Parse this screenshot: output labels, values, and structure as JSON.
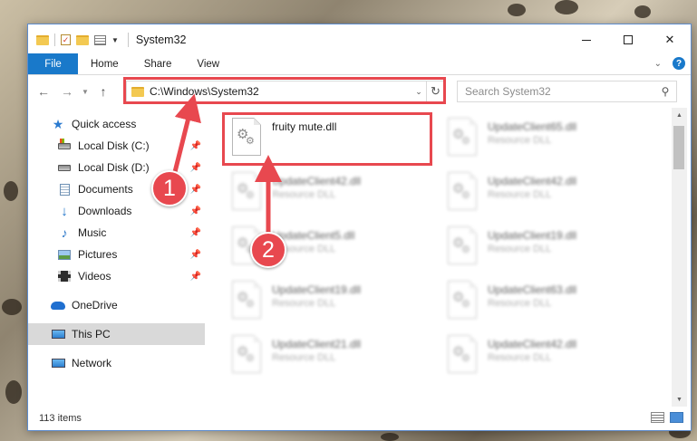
{
  "window": {
    "title": "System32",
    "controls": {
      "minimize": "minimize-icon",
      "maximize": "maximize-icon",
      "close": "✕"
    }
  },
  "ribbon": {
    "file_tab": "File",
    "tabs": [
      "Home",
      "Share",
      "View"
    ],
    "accent": "#1979ca"
  },
  "navigation": {
    "address_path": "C:\\Windows\\System32",
    "search_placeholder": "Search System32"
  },
  "sidebar": {
    "quick_access": "Quick access",
    "items": [
      {
        "label": "Local Disk (C:)",
        "icon": "drive-icon"
      },
      {
        "label": "Local Disk (D:)",
        "icon": "drive-icon"
      },
      {
        "label": "Documents",
        "icon": "documents-icon"
      },
      {
        "label": "Downloads",
        "icon": "downloads-icon"
      },
      {
        "label": "Music",
        "icon": "music-icon"
      },
      {
        "label": "Pictures",
        "icon": "pictures-icon"
      },
      {
        "label": "Videos",
        "icon": "videos-icon"
      }
    ],
    "onedrive": "OneDrive",
    "this_pc": "This PC",
    "network": "Network"
  },
  "files": [
    {
      "name": "fruity mute.dll",
      "type": ""
    },
    {
      "name": "UpdateClient65.dll",
      "type": "Resource DLL"
    },
    {
      "name": "UpdateClient42.dll",
      "type": "Resource DLL"
    },
    {
      "name": "UpdateClient42.dll",
      "type": "Resource DLL"
    },
    {
      "name": "UpdateClient5.dll",
      "type": "Resource DLL"
    },
    {
      "name": "UpdateClient19.dll",
      "type": "Resource DLL"
    },
    {
      "name": "UpdateClient19.dll",
      "type": "Resource DLL"
    },
    {
      "name": "UpdateClient63.dll",
      "type": "Resource DLL"
    },
    {
      "name": "UpdateClient21.dll",
      "type": "Resource DLL"
    },
    {
      "name": "UpdateClient42.dll",
      "type": "Resource DLL"
    }
  ],
  "status": {
    "item_count": "113 items"
  },
  "annotations": {
    "callout_1": "1",
    "callout_2": "2",
    "color": "#e8484f"
  }
}
